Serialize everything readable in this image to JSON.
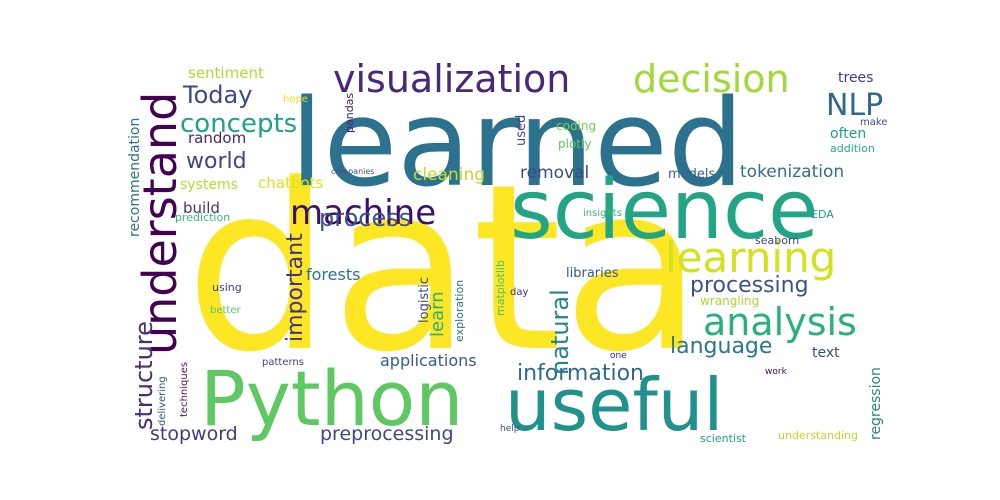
{
  "words": [
    {
      "text": "data",
      "color": "#fde725"
    },
    {
      "text": "learned",
      "color": "#2c728e"
    },
    {
      "text": "science",
      "color": "#21a585"
    },
    {
      "text": "Python",
      "color": "#5ec962"
    },
    {
      "text": "useful",
      "color": "#21918c"
    },
    {
      "text": "understand",
      "color": "#440154"
    },
    {
      "text": "visualization",
      "color": "#482878"
    },
    {
      "text": "decision",
      "color": "#a0da39"
    },
    {
      "text": "learning",
      "color": "#d2e21b"
    },
    {
      "text": "analysis",
      "color": "#2ab07f"
    },
    {
      "text": "machine",
      "color": "#3b0f70"
    },
    {
      "text": "NLP",
      "color": "#31688e"
    },
    {
      "text": "concepts",
      "color": "#1fa187"
    },
    {
      "text": "Today",
      "color": "#3e4989"
    },
    {
      "text": "process",
      "color": "#3b528b"
    },
    {
      "text": "world",
      "color": "#414487"
    },
    {
      "text": "important",
      "color": "#46327e"
    },
    {
      "text": "structure",
      "color": "#472d7b"
    },
    {
      "text": "natural",
      "color": "#25858e"
    },
    {
      "text": "processing",
      "color": "#3b528b"
    },
    {
      "text": "language",
      "color": "#2a788e"
    },
    {
      "text": "information",
      "color": "#31688e"
    },
    {
      "text": "stopword",
      "color": "#443983"
    },
    {
      "text": "preprocessing",
      "color": "#3f4788"
    },
    {
      "text": "cleaning",
      "color": "#bddf26"
    },
    {
      "text": "removal",
      "color": "#3e4a89"
    },
    {
      "text": "tokenization",
      "color": "#2d708e"
    },
    {
      "text": "applications",
      "color": "#38598c"
    },
    {
      "text": "learn",
      "color": "#29af7f"
    },
    {
      "text": "forests",
      "color": "#2c728e"
    },
    {
      "text": "random",
      "color": "#482475"
    },
    {
      "text": "build",
      "color": "#46307e"
    },
    {
      "text": "sentiment",
      "color": "#addc30"
    },
    {
      "text": "chatbots",
      "color": "#dde318"
    },
    {
      "text": "systems",
      "color": "#b5de2b"
    },
    {
      "text": "recommendation",
      "color": "#2c728e"
    },
    {
      "text": "regression",
      "color": "#26828e"
    },
    {
      "text": "text",
      "color": "#3e4989"
    },
    {
      "text": "trees",
      "color": "#443a83"
    },
    {
      "text": "often",
      "color": "#1fa088"
    },
    {
      "text": "models",
      "color": "#33638d"
    },
    {
      "text": "libraries",
      "color": "#3b528b"
    },
    {
      "text": "logistic",
      "color": "#3d4e8a"
    },
    {
      "text": "used",
      "color": "#3f4788"
    },
    {
      "text": "coding",
      "color": "#73d055"
    },
    {
      "text": "plotly",
      "color": "#5ec962"
    },
    {
      "text": "pandas",
      "color": "#482173"
    },
    {
      "text": "hope",
      "color": "#e5e419"
    },
    {
      "text": "make",
      "color": "#3e4c8a"
    },
    {
      "text": "addition",
      "color": "#27ad81"
    },
    {
      "text": "insights",
      "color": "#35b779"
    },
    {
      "text": "EDA",
      "color": "#1f9e89"
    },
    {
      "text": "seaborn",
      "color": "#414487"
    },
    {
      "text": "wrangling",
      "color": "#a5db36"
    },
    {
      "text": "matplotlib",
      "color": "#4ac16d"
    },
    {
      "text": "exploration",
      "color": "#2d708e"
    },
    {
      "text": "day",
      "color": "#472f7d"
    },
    {
      "text": "prediction",
      "color": "#3aba76"
    },
    {
      "text": "companies",
      "color": "#3e4a89"
    },
    {
      "text": "using",
      "color": "#424086"
    },
    {
      "text": "better",
      "color": "#56c667"
    },
    {
      "text": "patterns",
      "color": "#404688"
    },
    {
      "text": "techniques",
      "color": "#48196b"
    },
    {
      "text": "delivering",
      "color": "#3b528b"
    },
    {
      "text": "help",
      "color": "#3e4c8a"
    },
    {
      "text": "one",
      "color": "#482576"
    },
    {
      "text": "work",
      "color": "#460b5e"
    },
    {
      "text": "scientist",
      "color": "#1fa187"
    },
    {
      "text": "understanding",
      "color": "#bade28"
    }
  ]
}
